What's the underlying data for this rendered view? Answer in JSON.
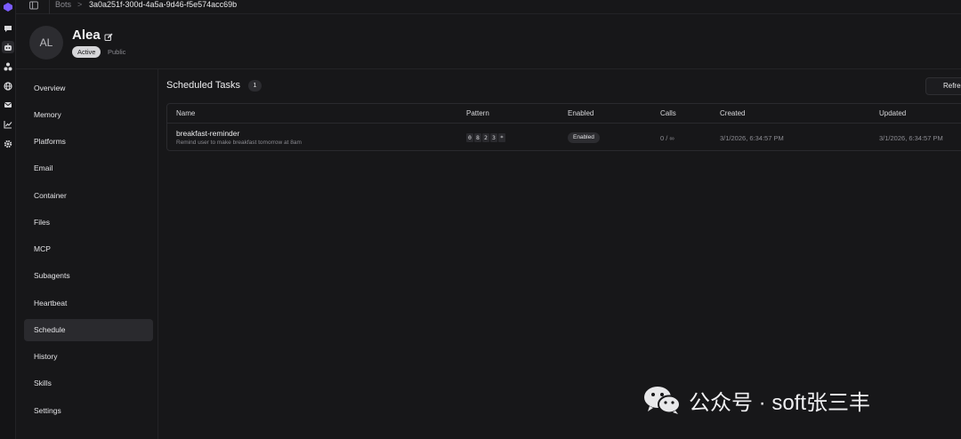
{
  "breadcrumb": {
    "root": "Bots",
    "separator": ">",
    "current": "3a0a251f-300d-4a5a-9d46-f5e574acc69b"
  },
  "rail": {
    "icons": [
      "logo-icon",
      "chat-icon",
      "bot-icon",
      "network-icon",
      "globe-icon",
      "mail-icon",
      "chart-icon",
      "settings-icon"
    ],
    "accent": "#7b5cff"
  },
  "bot": {
    "initials": "AL",
    "name": "Alea",
    "status": "Active",
    "visibility": "Public"
  },
  "nav": {
    "items": [
      "Overview",
      "Memory",
      "Platforms",
      "Email",
      "Container",
      "Files",
      "MCP",
      "Subagents",
      "Heartbeat",
      "Schedule",
      "History",
      "Skills",
      "Settings"
    ],
    "active": "Schedule"
  },
  "main": {
    "title": "Scheduled Tasks",
    "count": "1",
    "refresh_label": "Refresh"
  },
  "table": {
    "columns": [
      "Name",
      "Pattern",
      "Enabled",
      "Calls",
      "Created",
      "Updated"
    ],
    "rows": [
      {
        "name": "breakfast-reminder",
        "description": "Remind user to make breakfast tomorrow at 8am",
        "pattern": [
          "0",
          "8",
          "2",
          "3",
          "*"
        ],
        "enabled": "Enabled",
        "calls": "0 / ∞",
        "created": "3/1/2026, 6:34:57 PM",
        "updated": "3/1/2026, 6:34:57 PM"
      }
    ]
  },
  "watermark": {
    "text": "公众号 · soft张三丰"
  }
}
